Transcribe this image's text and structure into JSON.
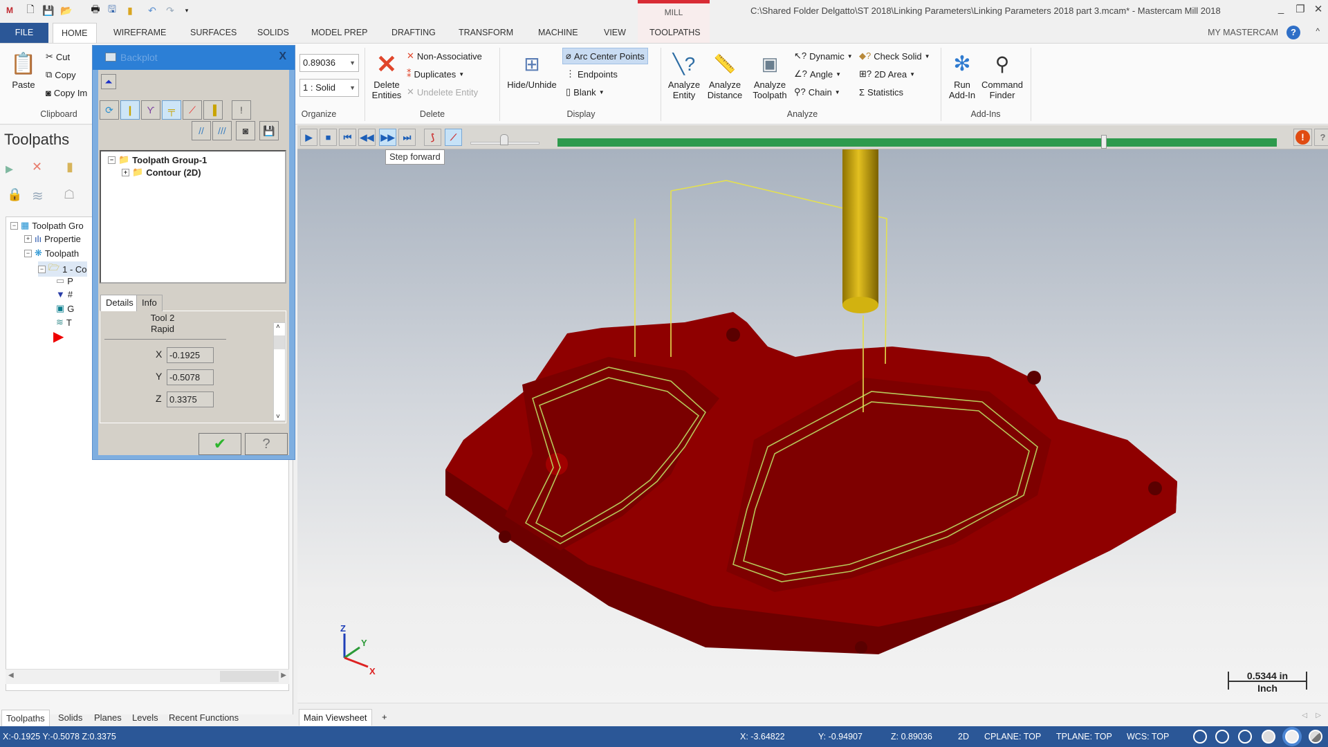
{
  "app": {
    "title": "C:\\Shared Folder Delgatto\\ST 2018\\Linking Parameters\\Linking Parameters 2018 part 3.mcam* - Mastercam Mill 2018",
    "context_tab_group": "MILL",
    "accent": "#2b5797",
    "logo": "mastercam-logo-icon",
    "quick_access": [
      "new-file-icon",
      "save-icon",
      "open-icon",
      "print-icon",
      "save-as-icon",
      "merge-icon",
      "undo-icon",
      "redo-icon",
      "customize-icon"
    ],
    "window_controls": {
      "minimize": "_",
      "restore": "❐",
      "close": "✕"
    }
  },
  "tabs": [
    {
      "label": "FILE"
    },
    {
      "label": "HOME",
      "active": true
    },
    {
      "label": "WIREFRAME"
    },
    {
      "label": "SURFACES"
    },
    {
      "label": "SOLIDS"
    },
    {
      "label": "MODEL PREP"
    },
    {
      "label": "DRAFTING"
    },
    {
      "label": "TRANSFORM"
    },
    {
      "label": "MACHINE"
    },
    {
      "label": "VIEW"
    },
    {
      "label": "TOOLPATHS"
    }
  ],
  "my_mastercam": "MY MASTERCAM",
  "ribbon": {
    "clipboard": {
      "label": "Clipboard",
      "paste": "Paste",
      "cut": "Cut",
      "copy": "Copy",
      "copy_image": "Copy Im"
    },
    "organize": {
      "label": "Organize",
      "z_depth": "0.89036",
      "level": "1 : Solid"
    },
    "delete": {
      "label": "Delete",
      "delete_entities": "Delete Entities",
      "non_associative": "Non-Associative",
      "duplicates": "Duplicates",
      "undelete": "Undelete Entity"
    },
    "display": {
      "label": "Display",
      "hide_unhide": "Hide/Unhide",
      "arc_center": "Arc Center Points",
      "endpoints": "Endpoints",
      "blank": "Blank"
    },
    "analyze": {
      "label": "Analyze",
      "entity": "Analyze Entity",
      "distance": "Analyze Distance",
      "toolpath": "Analyze Toolpath",
      "dynamic": "Dynamic",
      "angle": "Angle",
      "chain": "Chain",
      "check_solid": "Check Solid",
      "area_2d": "2D Area",
      "statistics": "Statistics"
    },
    "addins": {
      "label": "Add-Ins",
      "run": "Run Add-In",
      "finder": "Command Finder"
    }
  },
  "left_panel": {
    "title": "Toolpaths",
    "tree": [
      {
        "label": "Toolpath Gro",
        "icon": "machine-group-icon"
      },
      {
        "label": "Propertie",
        "icon": "properties-icon"
      },
      {
        "label": "Toolpath",
        "icon": "toolpath-group-icon"
      },
      {
        "label": "1 - Co",
        "icon": "operation-folder-icon"
      },
      {
        "label": "P",
        "icon": "parameters-icon"
      },
      {
        "label": "#",
        "icon": "tool-icon"
      },
      {
        "label": "G",
        "icon": "geometry-icon"
      },
      {
        "label": "T",
        "icon": "toolpath-icon"
      }
    ],
    "bottom_tabs": [
      "Toolpaths",
      "Solids",
      "Planes",
      "Levels",
      "Recent Functions"
    ]
  },
  "backplot": {
    "title": "Backplot",
    "tree": [
      {
        "label": "Toolpath Group-1"
      },
      {
        "label": "Contour (2D)"
      }
    ],
    "details_tab": "Details",
    "info_tab": "Info",
    "tool": "Tool 2",
    "move": "Rapid",
    "x_label": "X",
    "x": "-0.1925",
    "y_label": "Y",
    "y": "-0.5078",
    "z_label": "Z",
    "z": "0.3375"
  },
  "playback": {
    "tooltip": "Step forward",
    "progress": 0.76,
    "speed": 0.5
  },
  "viewport": {
    "scale_value": "0.5344 in",
    "scale_unit": "Inch",
    "axes": {
      "x": "X",
      "y": "Y",
      "z": "Z"
    },
    "part_color": "#8b0000",
    "tool_color": "#c9a400",
    "toolpath_color": "#c8d85a"
  },
  "sheets": {
    "main": "Main Viewsheet",
    "add": "+"
  },
  "status": {
    "cursor": "X:-0.1925  Y:-0.5078  Z:0.3375",
    "x": "X:  -3.64822",
    "y": "Y:  -0.94907",
    "z": "Z:  0.89036",
    "mode": "2D",
    "cplane": "CPLANE: TOP",
    "tplane": "TPLANE: TOP",
    "wcs": "WCS: TOP"
  }
}
